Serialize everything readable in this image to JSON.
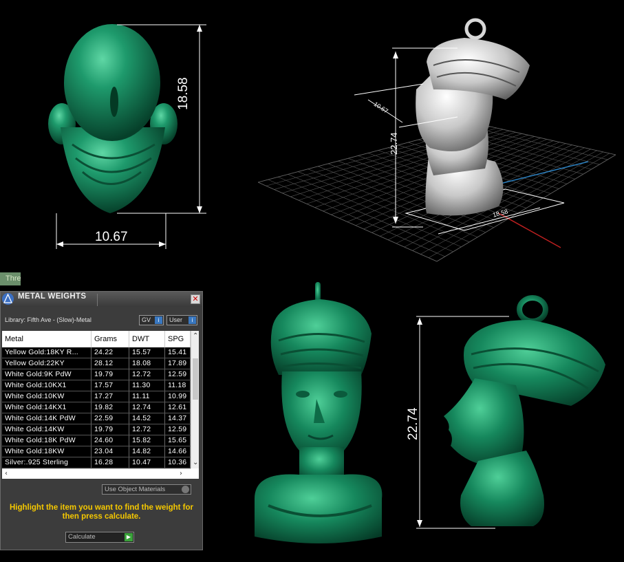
{
  "viewports": {
    "top_view_dimension_height": "18.58",
    "top_view_dimension_width": "10.67",
    "perspective_dimension_height": "22.74",
    "perspective_dimension_width": "18.58",
    "perspective_dimension_depth": "10.67",
    "side_view_dimension_height": "22.74"
  },
  "side_tab": {
    "label": "Thre"
  },
  "metal_weights": {
    "title": "METAL WEIGHTS",
    "close_icon": "close-icon",
    "library_label": "Library: Fifth Ave - (Slow)-Metal",
    "gv_label": "GV",
    "user_label": "User",
    "headers": [
      "Metal",
      "Grams",
      "DWT",
      "SPG"
    ],
    "rows": [
      [
        "Yellow Gold:18KY R...",
        "24.22",
        "15.57",
        "15.41"
      ],
      [
        "Yellow Gold:22KY",
        "28.12",
        "18.08",
        "17.89"
      ],
      [
        "White Gold:9K PdW",
        "19.79",
        "12.72",
        "12.59"
      ],
      [
        "White Gold:10KX1",
        "17.57",
        "11.30",
        "11.18"
      ],
      [
        "White Gold:10KW",
        "17.27",
        "11.11",
        "10.99"
      ],
      [
        "White Gold:14KX1",
        "19.82",
        "12.74",
        "12.61"
      ],
      [
        "White Gold:14K PdW",
        "22.59",
        "14.52",
        "14.37"
      ],
      [
        "White Gold:14KW",
        "19.79",
        "12.72",
        "12.59"
      ],
      [
        "White Gold:18K PdW",
        "24.60",
        "15.82",
        "15.65"
      ],
      [
        "White Gold:18KW",
        "23.04",
        "14.82",
        "14.66"
      ],
      [
        "Silver:.925 Sterling",
        "16.28",
        "10.47",
        "10.36"
      ]
    ],
    "use_object_materials": "Use Object Materials",
    "hint": "Highlight the item you want to find the weight for then press calculate.",
    "calculate_label": "Calculate"
  },
  "colors": {
    "jade": "#14805a",
    "highlight_text": "#f5c800",
    "panel_bg": "#3c3c3c"
  }
}
